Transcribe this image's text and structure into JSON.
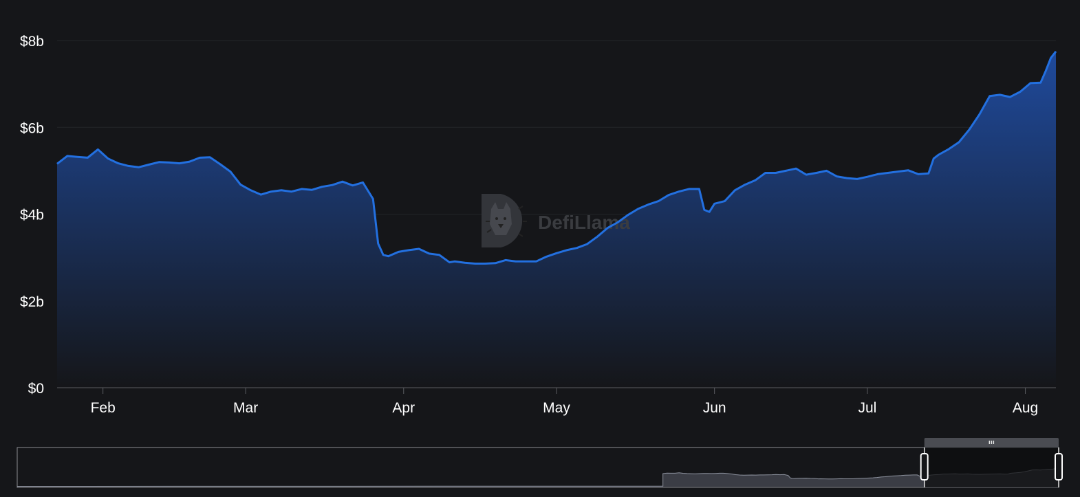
{
  "colors": {
    "background": "#151619",
    "line": "#2370e0",
    "area_top": "#1f4a9c",
    "area_bottom": "#151619",
    "axis_text": "#ffffff",
    "grid": "#232529",
    "axis_line": "#5a5c61",
    "navigator_fill": "#3b3d45",
    "navigator_line": "#8d929e",
    "navigator_selected": "#0c0c0e",
    "navigator_border": "#8a8c91",
    "watermark": "#3a3c40"
  },
  "watermark": {
    "text": "DefiLlama",
    "icon": "llama-logo-icon"
  },
  "navigator": {
    "grip_icon": "grip-lines-icon",
    "handle_icon": "range-handle-icon",
    "selection_start": 0.871,
    "selection_end": 1.0
  },
  "chart_data": {
    "type": "area",
    "title": "",
    "xlabel": "",
    "ylabel": "",
    "ylim": [
      0,
      8
    ],
    "y_ticks": [
      {
        "value": 0,
        "label": "$0"
      },
      {
        "value": 2,
        "label": "$2b"
      },
      {
        "value": 4,
        "label": "$4b"
      },
      {
        "value": 6,
        "label": "$6b"
      },
      {
        "value": 8,
        "label": "$8b"
      }
    ],
    "x_range": [
      "2023-01-23",
      "2023-08-07"
    ],
    "x_ticks": [
      {
        "date": "2023-02-01",
        "label": "Feb"
      },
      {
        "date": "2023-03-01",
        "label": "Mar"
      },
      {
        "date": "2023-04-01",
        "label": "Apr"
      },
      {
        "date": "2023-05-01",
        "label": "May"
      },
      {
        "date": "2023-06-01",
        "label": "Jun"
      },
      {
        "date": "2023-07-01",
        "label": "Jul"
      },
      {
        "date": "2023-08-01",
        "label": "Aug"
      }
    ],
    "grid": true,
    "legend": "none",
    "series": [
      {
        "x": [
          "2023-01-23",
          "2023-01-25",
          "2023-01-27",
          "2023-01-29",
          "2023-01-31",
          "2023-02-02",
          "2023-02-04",
          "2023-02-06",
          "2023-02-08",
          "2023-02-10",
          "2023-02-12",
          "2023-02-14",
          "2023-02-16",
          "2023-02-18",
          "2023-02-20",
          "2023-02-22",
          "2023-02-24",
          "2023-02-26",
          "2023-02-28",
          "2023-03-02",
          "2023-03-04",
          "2023-03-06",
          "2023-03-08",
          "2023-03-10",
          "2023-03-12",
          "2023-03-14",
          "2023-03-16",
          "2023-03-18",
          "2023-03-20",
          "2023-03-22",
          "2023-03-24",
          "2023-03-26",
          "2023-03-27",
          "2023-03-28",
          "2023-03-29",
          "2023-03-31",
          "2023-04-02",
          "2023-04-04",
          "2023-04-06",
          "2023-04-08",
          "2023-04-10",
          "2023-04-11",
          "2023-04-13",
          "2023-04-15",
          "2023-04-17",
          "2023-04-19",
          "2023-04-21",
          "2023-04-23",
          "2023-04-25",
          "2023-04-27",
          "2023-04-29",
          "2023-05-01",
          "2023-05-03",
          "2023-05-05",
          "2023-05-07",
          "2023-05-09",
          "2023-05-11",
          "2023-05-13",
          "2023-05-15",
          "2023-05-17",
          "2023-05-19",
          "2023-05-21",
          "2023-05-23",
          "2023-05-25",
          "2023-05-27",
          "2023-05-29",
          "2023-05-30",
          "2023-05-31",
          "2023-06-01",
          "2023-06-03",
          "2023-06-05",
          "2023-06-07",
          "2023-06-09",
          "2023-06-11",
          "2023-06-13",
          "2023-06-15",
          "2023-06-17",
          "2023-06-19",
          "2023-06-21",
          "2023-06-23",
          "2023-06-25",
          "2023-06-27",
          "2023-06-29",
          "2023-07-01",
          "2023-07-03",
          "2023-07-05",
          "2023-07-07",
          "2023-07-09",
          "2023-07-11",
          "2023-07-13",
          "2023-07-14",
          "2023-07-15",
          "2023-07-17",
          "2023-07-19",
          "2023-07-21",
          "2023-07-23",
          "2023-07-25",
          "2023-07-27",
          "2023-07-29",
          "2023-07-31",
          "2023-08-02",
          "2023-08-04",
          "2023-08-05",
          "2023-08-06",
          "2023-08-07"
        ],
        "values": [
          5.16,
          5.34,
          5.32,
          5.3,
          5.49,
          5.28,
          5.17,
          5.11,
          5.08,
          5.14,
          5.2,
          5.19,
          5.17,
          5.21,
          5.3,
          5.31,
          5.15,
          4.98,
          4.68,
          4.55,
          4.45,
          4.52,
          4.55,
          4.52,
          4.58,
          4.56,
          4.63,
          4.67,
          4.75,
          4.66,
          4.73,
          4.35,
          3.32,
          3.06,
          3.03,
          3.13,
          3.17,
          3.2,
          3.09,
          3.06,
          2.89,
          2.91,
          2.88,
          2.86,
          2.86,
          2.87,
          2.94,
          2.91,
          2.91,
          2.91,
          3.02,
          3.1,
          3.17,
          3.22,
          3.31,
          3.48,
          3.68,
          3.81,
          3.98,
          4.12,
          4.22,
          4.3,
          4.44,
          4.52,
          4.58,
          4.58,
          4.1,
          4.05,
          4.24,
          4.3,
          4.55,
          4.68,
          4.78,
          4.95,
          4.95,
          5.0,
          5.05,
          4.91,
          4.95,
          5.0,
          4.87,
          4.83,
          4.81,
          4.86,
          4.92,
          4.95,
          4.98,
          5.01,
          4.92,
          4.94,
          5.28,
          5.37,
          5.5,
          5.66,
          5.95,
          6.3,
          6.72,
          6.75,
          6.7,
          6.82,
          7.02,
          7.03,
          7.3,
          7.6,
          7.75
        ]
      }
    ]
  }
}
